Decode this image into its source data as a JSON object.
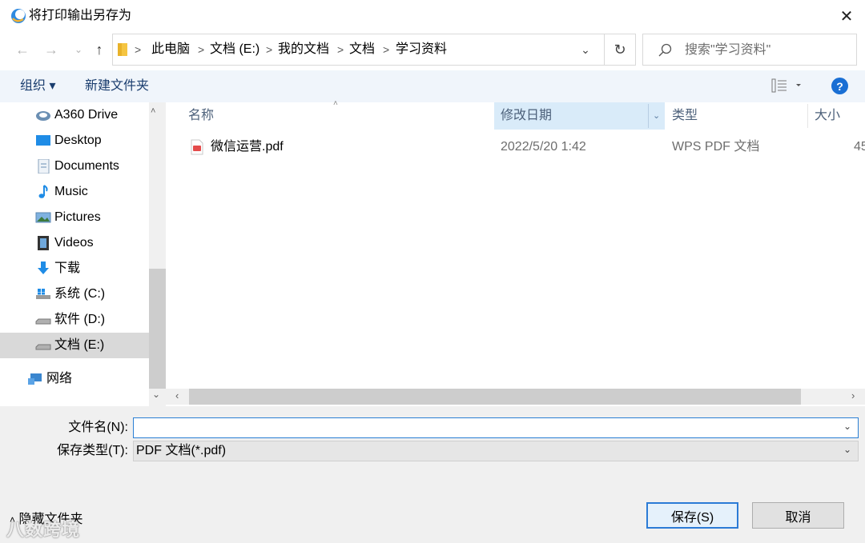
{
  "window": {
    "title": "将打印输出另存为",
    "close_label": "✕"
  },
  "address": {
    "crumbs": [
      "此电脑",
      "文档 (E:)",
      "我的文档",
      "文档",
      "学习资料"
    ],
    "separator": ">"
  },
  "search": {
    "placeholder": "搜索\"学习资料\""
  },
  "toolbar": {
    "organize_label": "组织 ▾",
    "new_folder_label": "新建文件夹",
    "help_label": "?"
  },
  "nav": {
    "items": [
      {
        "label": "A360 Drive",
        "icon": "cloud-drive-icon"
      },
      {
        "label": "Desktop",
        "icon": "desktop-icon"
      },
      {
        "label": "Documents",
        "icon": "documents-icon"
      },
      {
        "label": "Music",
        "icon": "music-icon"
      },
      {
        "label": "Pictures",
        "icon": "pictures-icon"
      },
      {
        "label": "Videos",
        "icon": "videos-icon"
      },
      {
        "label": "下载",
        "icon": "download-icon"
      },
      {
        "label": "系统 (C:)",
        "icon": "drive-icon"
      },
      {
        "label": "软件 (D:)",
        "icon": "drive-icon"
      },
      {
        "label": "文档 (E:)",
        "icon": "drive-icon"
      },
      {
        "label": "网络",
        "icon": "network-icon"
      }
    ],
    "selected_index": 9
  },
  "columns": {
    "name": "名称",
    "date": "修改日期",
    "type": "类型",
    "size": "大小"
  },
  "files": [
    {
      "name": "微信运营.pdf",
      "date": "2022/5/20 1:42",
      "type": "WPS PDF 文档",
      "size": "45"
    }
  ],
  "form": {
    "filename_label": "文件名(N):",
    "filename_value": "",
    "filetype_label": "保存类型(T):",
    "filetype_value": "PDF 文档(*.pdf)"
  },
  "buttons": {
    "save": "保存(S)",
    "cancel": "取消",
    "hide_folders": "隐藏文件夹"
  },
  "watermark": "八数跨境",
  "colors": {
    "accent": "#2b7bd6",
    "selected_column": "#d9ebf9",
    "command_bar": "#f0f5fb"
  }
}
